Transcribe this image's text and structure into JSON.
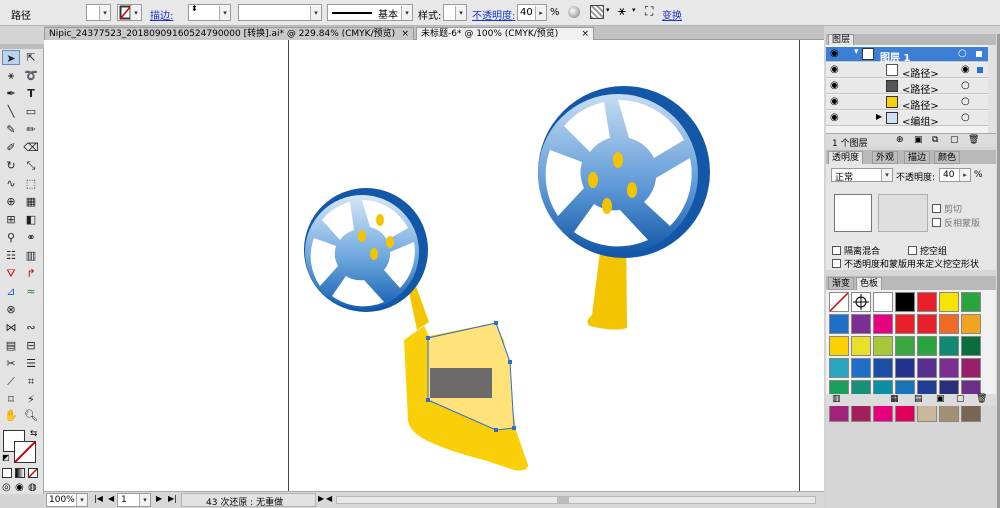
{
  "control_bar": {
    "selection_label": "路径",
    "stroke_label": "描边:",
    "stroke_weight": "",
    "stroke_profile": "基本",
    "style_label": "样式:",
    "opacity_label": "不透明度:",
    "opacity_value": "40",
    "opacity_unit": "%",
    "transform_label": "变换"
  },
  "tabs": [
    {
      "label": "Nipic_24377523_20180909160524790000  [转换].ai* @ 229.84% (CMYK/预览)",
      "close": "×"
    },
    {
      "label": "未标题-6* @ 100% (CMYK/预览)",
      "close": "×"
    }
  ],
  "status_bar": {
    "zoom": "100%",
    "page": "1",
    "history_text": "43 次还原 : 无重做"
  },
  "layers_panel": {
    "tab": "图层",
    "rows": [
      {
        "name": "图层 1"
      },
      {
        "name": "<路径>"
      },
      {
        "name": "<路径>"
      },
      {
        "name": "<路径>"
      },
      {
        "name": "<编组>"
      }
    ],
    "footer_count": "1 个图层"
  },
  "transparency_panel": {
    "tabs": [
      "透明度",
      "外观",
      "描边",
      "颜色"
    ],
    "blend_mode": "正常",
    "opacity_label": "不透明度:",
    "opacity_value": "40",
    "opacity_unit": "%",
    "clip_label": "剪切",
    "invert_mask_label": "反相蒙版",
    "isolate_blending_label": "隔离混合",
    "knockout_group_label": "挖空组",
    "opacity_mask_label": "不透明度和蒙版用来定义挖空形状"
  },
  "swatches_panel": {
    "tabs": [
      "渐变",
      "色板"
    ],
    "colors": [
      "#ffffff",
      "#ffffff",
      "#ffffff",
      "#000000",
      "#e8202a",
      "#f5e500",
      "#2aa43f",
      "#1e6fc8",
      "#7b2f93",
      "#e6007e",
      "#e8202a",
      "#e8202a",
      "#ee6a25",
      "#f2a31f",
      "#fbd100",
      "#e8e02a",
      "#a4c83a",
      "#3aa640",
      "#2aa43f",
      "#0f8a72",
      "#0a6d3d",
      "#2aa7c0",
      "#1e6fc8",
      "#1b4fa6",
      "#23338f",
      "#5b2f8f",
      "#7b2f93",
      "#9a1f6a",
      "#1aa05a",
      "#179078",
      "#0c8fa2",
      "#1873b6",
      "#1e3f94",
      "#2a2f7c",
      "#6b2f8a",
      "#a0227a",
      "#a51f5a",
      "#e6007e",
      "#e0005c",
      "#c9b79a",
      "#a38f73",
      "#7a6550"
    ]
  },
  "colors": {
    "reel_blue_dark": "#1560b0",
    "reel_blue_light": "#c7ddf2",
    "hub_yellow": "#f5c400",
    "handle_yellow": "#f9cf0a",
    "highlight_yellow": "#ffe27a",
    "screen_gray": "#6d6a6b",
    "selection_blue": "#2d6cd6"
  }
}
